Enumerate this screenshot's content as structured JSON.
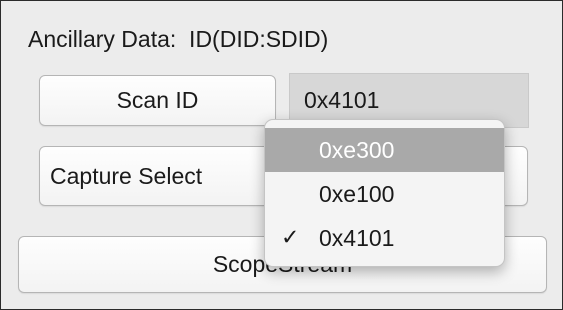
{
  "panel": {
    "title": "Ancillary Data:  ID(DID:SDID)",
    "scan_button": "Scan ID",
    "current_id": "0x4101",
    "capture_button": "Capture Select",
    "scope_button": "ScopeStream"
  },
  "dropdown": {
    "options": [
      {
        "label": "0xe300",
        "highlighted": true,
        "checked": false
      },
      {
        "label": "0xe100",
        "highlighted": false,
        "checked": false
      },
      {
        "label": "0x4101",
        "highlighted": false,
        "checked": true
      }
    ],
    "check_mark": "✓"
  },
  "colors": {
    "panel_bg": "#ececec",
    "highlight_bg": "#a9a9a9",
    "display_bg": "#d7d7d7"
  }
}
